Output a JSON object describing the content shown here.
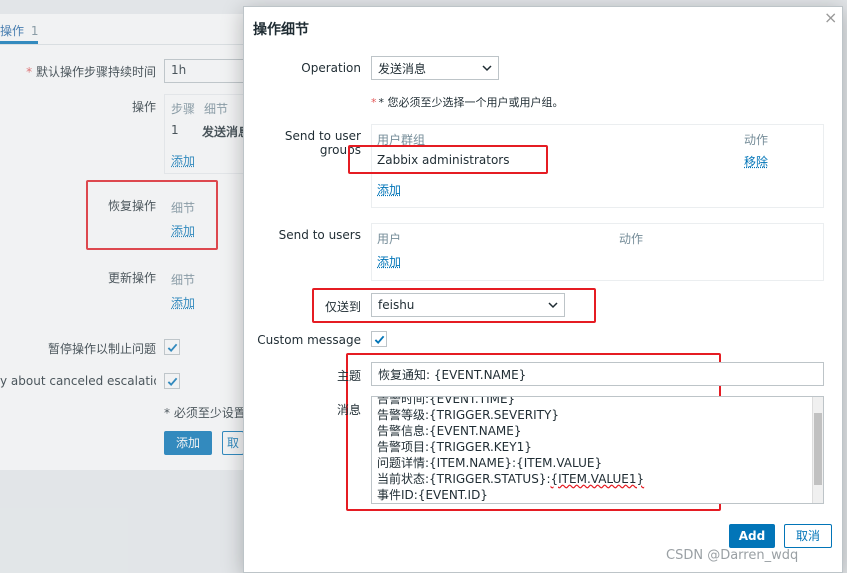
{
  "background_form": {
    "tab_label": "操作",
    "tab_count": "1",
    "default_duration_label": "默认操作步骤持续时间",
    "default_duration_value": "1h",
    "operations_label": "操作",
    "operations_cols": [
      "步骤",
      "细节"
    ],
    "operations_row": {
      "step": "1",
      "detail": "发送消息"
    },
    "add_link": "添加",
    "recovery_label": "恢复操作",
    "recovery_col": "细节",
    "update_label": "更新操作",
    "update_col": "细节",
    "pause_label": "暂停操作以制止问题",
    "notify_label": "y about canceled escalations",
    "required_note": "* 必须至少设置",
    "add_button": "添加",
    "cancel_button": "取"
  },
  "dialog": {
    "title": "操作细节",
    "close_icon": "×",
    "operation_label": "Operation",
    "operation_value": "发送消息",
    "required_hint": "* 您必须至少选择一个用户或用户组。",
    "send_groups_label": "Send to user groups",
    "groups_col_user_group": "用户群组",
    "groups_col_action": "动作",
    "group_name": "Zabbix administrators",
    "remove_link": "移除",
    "add_link": "添加",
    "send_users_label": "Send to users",
    "users_col_user": "用户",
    "users_col_action": "动作",
    "only_send_to_label": "仅送到",
    "only_send_to_value": "feishu",
    "custom_message_label": "Custom message",
    "subject_label": "主题",
    "subject_value": "恢复通知: {EVENT.NAME}",
    "message_label": "消息",
    "message_lines": [
      "告警时间:{EVENT.TIME}",
      "告警等级:{TRIGGER.SEVERITY}",
      "告警信息:{EVENT.NAME}",
      "告警项目:{TRIGGER.KEY1}",
      "问题详情:{ITEM.NAME}:{ITEM.VALUE}",
      "当前状态:{TRIGGER.STATUS}:",
      "事件ID:{EVENT.ID}"
    ],
    "status_value_part": "{ITEM.VALUE1}",
    "add_button": "Add",
    "cancel_button": "取消"
  },
  "watermark": "CSDN @Darren_wdq",
  "colors": {
    "accent": "#0275b8",
    "annotation_red": "#e51c23",
    "required_red": "#e45959"
  }
}
